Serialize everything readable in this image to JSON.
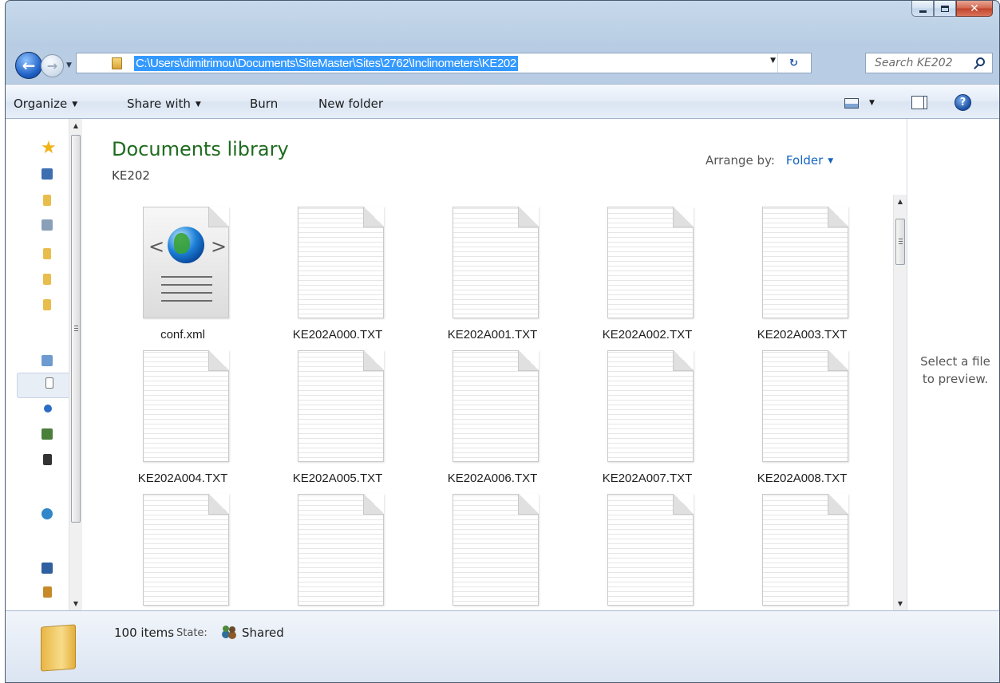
{
  "window": {
    "caption": {
      "minimize": "minimize",
      "maximize": "maximize",
      "close": "✕"
    }
  },
  "navbar": {
    "back": "←",
    "forward": "→",
    "address": "C:\\Users\\dimitrimou\\Documents\\SiteMaster\\Sites\\2762\\Inclinometers\\KE202",
    "search_placeholder": "Search KE202"
  },
  "toolbar": {
    "organize": "Organize",
    "share_with": "Share with",
    "burn": "Burn",
    "new_folder": "New folder",
    "help": "?"
  },
  "library": {
    "title": "Documents library",
    "subtitle": "KE202",
    "arrange_label": "Arrange by:",
    "arrange_value": "Folder"
  },
  "files": [
    {
      "name": "conf.xml",
      "icon": "xml-document-icon"
    },
    {
      "name": "KE202A000.TXT",
      "icon": "text-document-icon"
    },
    {
      "name": "KE202A001.TXT",
      "icon": "text-document-icon"
    },
    {
      "name": "KE202A002.TXT",
      "icon": "text-document-icon"
    },
    {
      "name": "KE202A003.TXT",
      "icon": "text-document-icon"
    },
    {
      "name": "KE202A004.TXT",
      "icon": "text-document-icon"
    },
    {
      "name": "KE202A005.TXT",
      "icon": "text-document-icon"
    },
    {
      "name": "KE202A006.TXT",
      "icon": "text-document-icon"
    },
    {
      "name": "KE202A007.TXT",
      "icon": "text-document-icon"
    },
    {
      "name": "KE202A008.TXT",
      "icon": "text-document-icon"
    },
    {
      "name": "",
      "icon": "text-document-icon"
    },
    {
      "name": "",
      "icon": "text-document-icon"
    },
    {
      "name": "",
      "icon": "text-document-icon"
    },
    {
      "name": "",
      "icon": "text-document-icon"
    },
    {
      "name": "",
      "icon": "text-document-icon"
    }
  ],
  "preview": {
    "message": "Select a file to preview."
  },
  "details": {
    "count": "100 items",
    "state_label": "State:",
    "state_value": "Shared"
  },
  "colors": {
    "library_title": "#1e6b1e",
    "link_blue": "#1565c0",
    "selection": "#3399ff"
  }
}
